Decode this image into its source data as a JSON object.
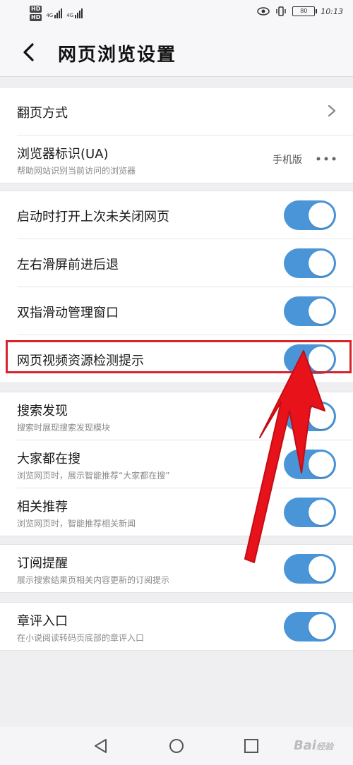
{
  "status_bar": {
    "hd1": "HD",
    "hd2": "HD",
    "sig1_label": "4G",
    "sig2_label": "4G",
    "time": "10:13",
    "battery": "80"
  },
  "header": {
    "title": "网页浏览设置"
  },
  "groups": [
    {
      "rows": [
        {
          "title": "翻页方式",
          "control": "chevron"
        },
        {
          "title": "浏览器标识(UA)",
          "subtitle": "帮助网站识别当前访问的浏览器",
          "value": "手机版",
          "control": "more"
        }
      ]
    },
    {
      "rows": [
        {
          "title": "启动时打开上次未关闭网页",
          "toggle": true
        },
        {
          "title": "左右滑屏前进后退",
          "toggle": true
        },
        {
          "title": "双指滑动管理窗口",
          "toggle": true
        },
        {
          "title": "网页视频资源检测提示",
          "toggle": true
        }
      ]
    },
    {
      "rows": [
        {
          "title": "搜索发现",
          "subtitle": "搜索时展现搜索发现模块",
          "toggle": true
        },
        {
          "title": "大家都在搜",
          "subtitle": "浏览网页时，展示智能推荐“大家都在搜”",
          "toggle": true
        },
        {
          "title": "相关推荐",
          "subtitle": "浏览网页时，智能推荐相关新闻",
          "toggle": true
        }
      ]
    },
    {
      "rows": [
        {
          "title": "订阅提醒",
          "subtitle": "展示搜索结果页相关内容更新的订阅提示",
          "toggle": true
        }
      ]
    },
    {
      "rows": [
        {
          "title": "章评入口",
          "subtitle": "在小说阅读转码页底部的章评入口",
          "toggle": true
        }
      ]
    }
  ],
  "colors": {
    "toggle_on": "#4a95d8",
    "highlight": "#d8232a",
    "background": "#efeff1"
  },
  "watermark": {
    "text": "Bai",
    "suffix": "经验"
  }
}
